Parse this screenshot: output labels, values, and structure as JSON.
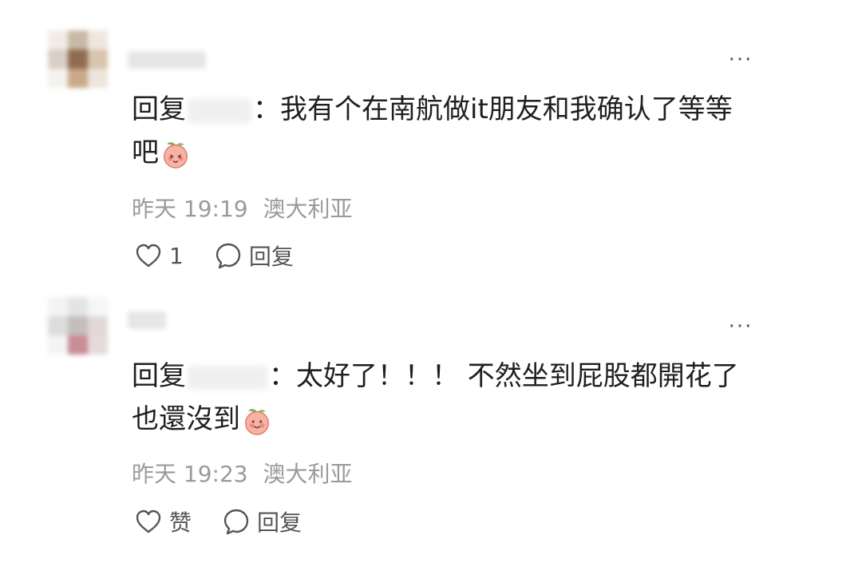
{
  "comments": [
    {
      "reply_prefix": "回复",
      "separator": "：",
      "text_line1": "我有个在南航做it朋友和我确认了等等",
      "text_line2": "吧",
      "emoji": "peach-face-emoji",
      "time": "昨天 19:19",
      "location": "澳大利亚",
      "like_label": "1",
      "reply_label": "回复"
    },
    {
      "reply_prefix": "回复",
      "separator": "：",
      "text_line1": "太好了！！！ 不然坐到屁股都開花了",
      "text_line2": "也還沒到",
      "emoji": "peach-face-emoji",
      "time": "昨天 19:23",
      "location": "澳大利亚",
      "like_label": "赞",
      "reply_label": "回复"
    }
  ],
  "more_label": "···",
  "colors": {
    "text": "#1f1f1f",
    "meta": "#9a9a9a",
    "icon": "#555555"
  }
}
